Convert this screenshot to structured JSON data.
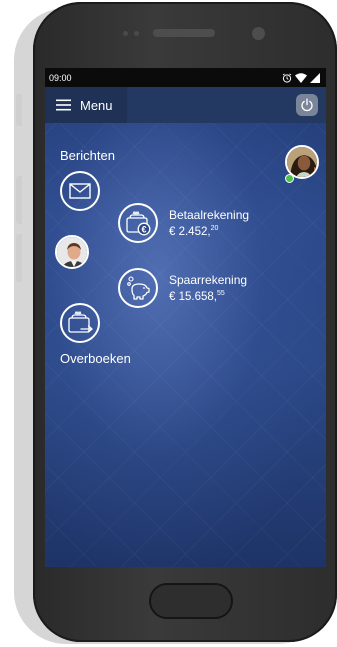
{
  "status_bar": {
    "time": "09:00"
  },
  "header": {
    "menu_label": "Menu"
  },
  "messages": {
    "label": "Berichten"
  },
  "accounts": [
    {
      "name": "Betaalrekening",
      "balance_main": "€ 2.452,",
      "balance_cents": "20"
    },
    {
      "name": "Spaarrekening",
      "balance_main": "€ 15.658,",
      "balance_cents": "55"
    }
  ],
  "transfer": {
    "label": "Overboeken"
  },
  "colors": {
    "screen_bg": "#2b4887",
    "topbar": "#243962",
    "online": "#4cc14c"
  },
  "icons": [
    "hamburger-icon",
    "power-icon",
    "envelope-icon",
    "wallet-euro-icon",
    "piggy-bank-icon",
    "wallet-transfer-icon",
    "alarm-icon",
    "wifi-icon",
    "signal-icon"
  ]
}
